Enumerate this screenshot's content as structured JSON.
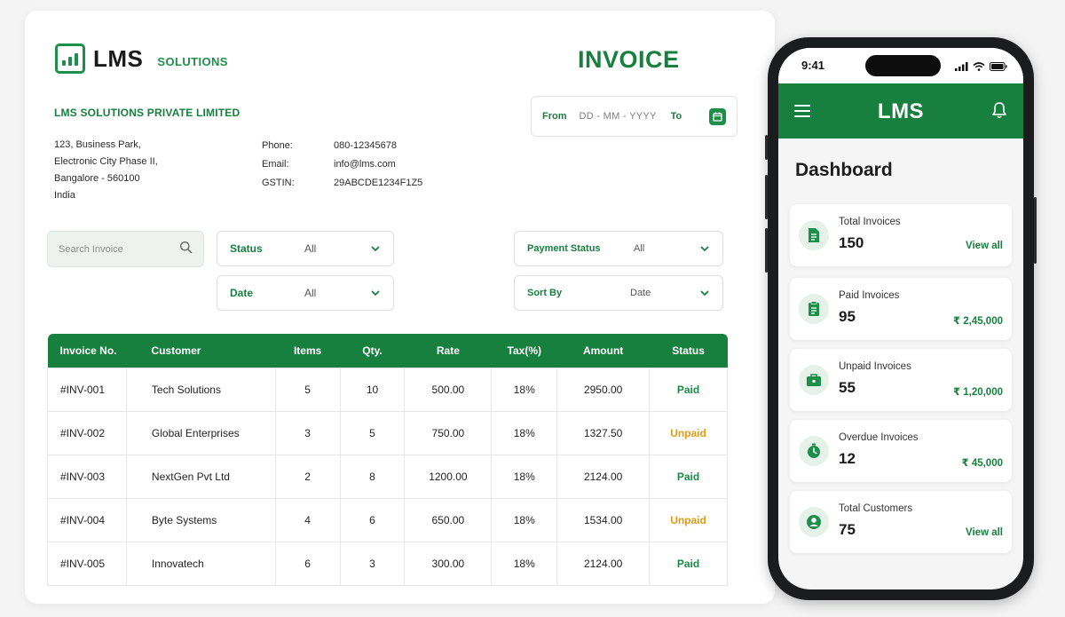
{
  "invoice": {
    "logo": {
      "name": "LMS",
      "tagline": "SOLUTIONS"
    },
    "title": "INVOICE",
    "date_filter": {
      "from_label": "From",
      "placeholder": "DD - MM - YYYY",
      "to_label": "To"
    },
    "company": {
      "name": "LMS SOLUTIONS PRIVATE LIMITED",
      "address": [
        "123, Business Park,",
        "Electronic City Phase II,",
        "Bangalore - 560100",
        "India"
      ],
      "contacts": [
        {
          "key": "Phone:",
          "value": "080-12345678"
        },
        {
          "key": "Email:",
          "value": "info@lms.com"
        },
        {
          "key": "GSTIN:",
          "value": "29ABCDE1234F1Z5"
        }
      ]
    },
    "search": {
      "placeholder": "Search Invoice"
    },
    "filters": {
      "status": {
        "label": "Status",
        "value": "All"
      },
      "date": {
        "label": "Date",
        "value": "All"
      },
      "payment_status": {
        "label": "Payment Status",
        "value": "All"
      },
      "sort_by": {
        "label": "Sort By",
        "value": "Date"
      }
    },
    "table": {
      "headers": [
        "Invoice No.",
        "Customer",
        "Items",
        "Qty.",
        "Rate",
        "Tax(%)",
        "Amount",
        "Status"
      ],
      "rows": [
        [
          "#INV-001",
          "Tech Solutions",
          "5",
          "10",
          "500.00",
          "18%",
          "2950.00",
          "Paid"
        ],
        [
          "#INV-002",
          "Global Enterprises",
          "3",
          "5",
          "750.00",
          "18%",
          "1327.50",
          "Unpaid"
        ],
        [
          "#INV-003",
          "NextGen Pvt Ltd",
          "2",
          "8",
          "1200.00",
          "18%",
          "2124.00",
          "Paid"
        ],
        [
          "#INV-004",
          "Byte Systems",
          "4",
          "6",
          "650.00",
          "18%",
          "1534.00",
          "Unpaid"
        ],
        [
          "#INV-005",
          "Innovatech",
          "6",
          "3",
          "300.00",
          "18%",
          "2124.00",
          "Paid"
        ]
      ]
    }
  },
  "phone": {
    "time": "9:41",
    "app_title": "LMS",
    "dashboard_title": "Dashboard",
    "stats": [
      {
        "label": "Total Invoices",
        "value": "150",
        "right": "View all",
        "icon": "document-icon"
      },
      {
        "label": "Paid Invoices",
        "value": "95",
        "right": "₹ 2,45,000",
        "icon": "clipboard-check-icon"
      },
      {
        "label": "Unpaid Invoices",
        "value": "55",
        "right": "₹ 1,20,000",
        "icon": "briefcase-icon"
      },
      {
        "label": "Overdue Invoices",
        "value": "12",
        "right": "₹ 45,000",
        "icon": "clock-icon"
      },
      {
        "label": "Total Customers",
        "value": "75",
        "right": "View all",
        "icon": "user-icon"
      }
    ]
  },
  "colors": {
    "primary": "#17803e",
    "unpaid": "#e29b18",
    "light_green": "#e6f1ea"
  }
}
